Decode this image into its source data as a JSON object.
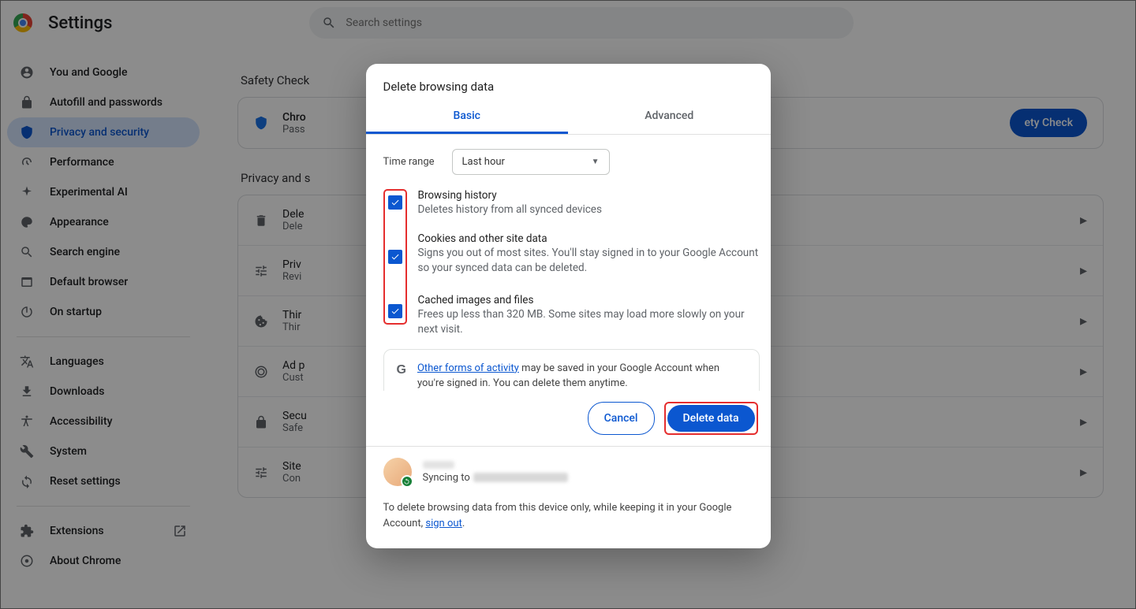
{
  "header": {
    "title": "Settings",
    "search_placeholder": "Search settings"
  },
  "sidebar": {
    "items": [
      {
        "label": "You and Google"
      },
      {
        "label": "Autofill and passwords"
      },
      {
        "label": "Privacy and security"
      },
      {
        "label": "Performance"
      },
      {
        "label": "Experimental AI"
      },
      {
        "label": "Appearance"
      },
      {
        "label": "Search engine"
      },
      {
        "label": "Default browser"
      },
      {
        "label": "On startup"
      }
    ],
    "group2": [
      {
        "label": "Languages"
      },
      {
        "label": "Downloads"
      },
      {
        "label": "Accessibility"
      },
      {
        "label": "System"
      },
      {
        "label": "Reset settings"
      }
    ],
    "group3": [
      {
        "label": "Extensions"
      },
      {
        "label": "About Chrome"
      }
    ]
  },
  "content": {
    "safety_heading": "Safety Check",
    "safety": {
      "primary": "Chro",
      "secondary": "Pass",
      "button": "ety Check"
    },
    "privacy_heading": "Privacy and s",
    "rows": [
      {
        "primary": "Dele",
        "secondary": "Dele"
      },
      {
        "primary": "Priv",
        "secondary": "Revi"
      },
      {
        "primary": "Thir",
        "secondary": "Thir"
      },
      {
        "primary": "Ad p",
        "secondary": "Cust"
      },
      {
        "primary": "Secu",
        "secondary": "Safe"
      },
      {
        "primary": "Site",
        "secondary": "Con"
      }
    ]
  },
  "dialog": {
    "title": "Delete browsing data",
    "tabs": {
      "basic": "Basic",
      "advanced": "Advanced"
    },
    "time_label": "Time range",
    "time_value": "Last hour",
    "options": [
      {
        "label": "Browsing history",
        "sub": "Deletes history from all synced devices"
      },
      {
        "label": "Cookies and other site data",
        "sub": "Signs you out of most sites. You'll stay signed in to your Google Account so your synced data can be deleted."
      },
      {
        "label": "Cached images and files",
        "sub": "Frees up less than 320 MB. Some sites may load more slowly on your next visit."
      }
    ],
    "note_link": "Other forms of activity",
    "note_rest": " may be saved in your Google Account when you're signed in. You can delete them anytime.",
    "cancel": "Cancel",
    "delete": "Delete data",
    "sync_prefix": "Syncing to ",
    "footer_pre": "To delete browsing data from this device only, while keeping it in your Google Account, ",
    "signout": "sign out",
    "footer_post": "."
  }
}
